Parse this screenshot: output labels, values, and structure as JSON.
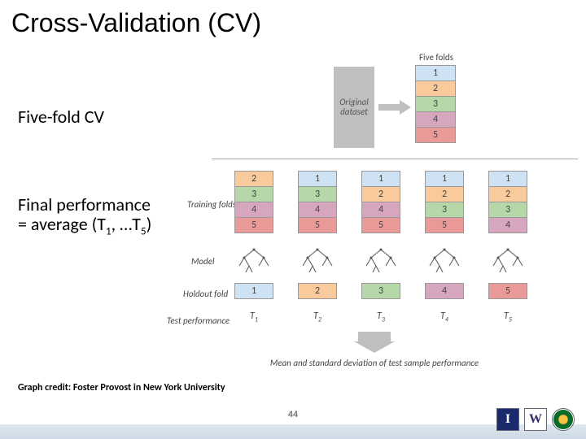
{
  "title": "Cross-Validation (CV)",
  "left": {
    "subhead": "Five-fold CV",
    "perf_line1": "Final performance",
    "perf_line2_pre": "= average (T",
    "perf_line2_mid": ", …T",
    "perf_line2_post": ")",
    "credit": "Graph credit: Foster Provost in New York University"
  },
  "diagram": {
    "orig_label": "Original dataset",
    "five_folds_label": "Five folds",
    "fold_stack": [
      "1",
      "2",
      "3",
      "4",
      "5"
    ],
    "training_label": "Training folds",
    "model_label": "Model",
    "holdout_label": "Holdout fold",
    "testperf_label": "Test performance",
    "columns": [
      {
        "train": [
          "2",
          "3",
          "4",
          "5"
        ],
        "hold": "1",
        "hold_class": "c1",
        "t": "1"
      },
      {
        "train": [
          "1",
          "3",
          "4",
          "5"
        ],
        "hold": "2",
        "hold_class": "c2",
        "t": "2"
      },
      {
        "train": [
          "1",
          "2",
          "4",
          "5"
        ],
        "hold": "3",
        "hold_class": "c3",
        "t": "3"
      },
      {
        "train": [
          "1",
          "2",
          "3",
          "5"
        ],
        "hold": "4",
        "hold_class": "c4",
        "t": "4"
      },
      {
        "train": [
          "1",
          "2",
          "3",
          "4"
        ],
        "hold": "5",
        "hold_class": "c5",
        "t": "5"
      }
    ],
    "cell_class_map": {
      "1": "c1",
      "2": "c2",
      "3": "c3",
      "4": "c4",
      "5": "c5"
    },
    "msd": "Mean and standard deviation of test sample performance"
  },
  "page_number": "44",
  "logos": {
    "i": "I",
    "w": "W"
  }
}
